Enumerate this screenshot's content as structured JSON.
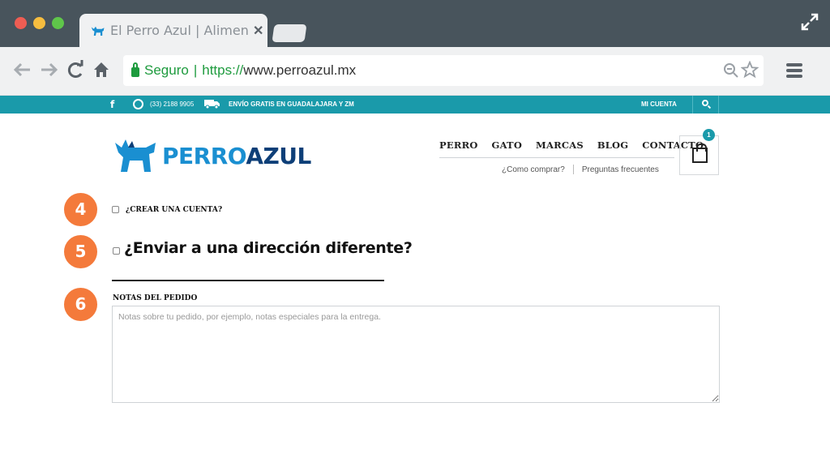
{
  "browser": {
    "tab_title": "El Perro Azul | Alimen...",
    "tab_close": "✕",
    "address": {
      "secure_label": "Seguro",
      "separator": "|",
      "scheme": "https://",
      "host": "www.perroazul.mx"
    }
  },
  "topbar": {
    "facebook": "f",
    "phone": "(33) 2188 9905",
    "shipping": "ENVÍO GRATIS EN GUADALAJARA Y ZM",
    "account": "MI CUENTA"
  },
  "header": {
    "logo_part1": "PERRO",
    "logo_part2": "AZUL",
    "nav": [
      "PERRO",
      "GATO",
      "MARCAS",
      "BLOG",
      "CONTACTO"
    ],
    "subnav": [
      "¿Como comprar?",
      "Preguntas frecuentes"
    ],
    "cart_count": "1"
  },
  "steps": [
    "4",
    "5",
    "6"
  ],
  "checkout": {
    "create_account": "¿CREAR UNA CUENTA?",
    "ship_different": "¿Enviar a una dirección diferente?",
    "notes_label": "NOTAS DEL PEDIDO",
    "notes_placeholder": "Notas sobre tu pedido, por ejemplo, notas especiales para la entrega."
  },
  "colors": {
    "teal": "#1a9aaa",
    "step_orange": "#f47a3b",
    "logo_light": "#1a8fd1",
    "logo_dark": "#0e3f78",
    "secure_green": "#1e9b3e"
  }
}
